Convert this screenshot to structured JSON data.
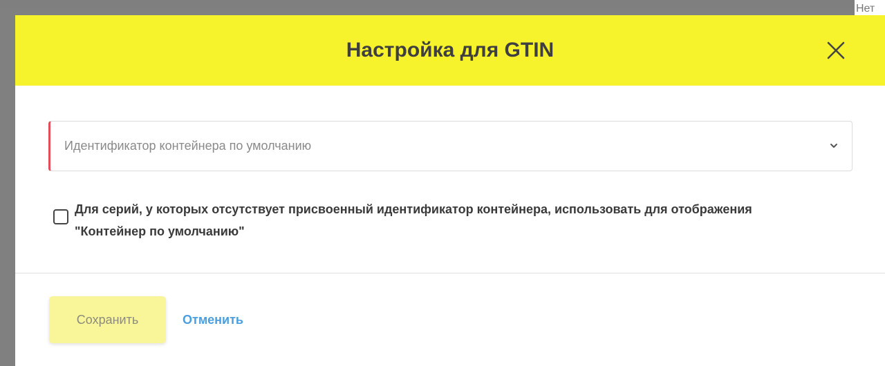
{
  "background": {
    "fragment_text": "Нет"
  },
  "dialog": {
    "title": "Настройка для GTIN",
    "close_icon": "close-icon",
    "header_color": "#f6f22b"
  },
  "form": {
    "container_select": {
      "placeholder": "Идентификатор контейнера по умолчанию",
      "value": "",
      "required_marker_color": "#e34d59",
      "icon": "chevron-down-icon"
    },
    "default_container_checkbox": {
      "checked": false,
      "label": "Для серий, у которых отсутствует присвоенный идентификатор контейнера, использовать для отображения \"Контейнер по умолчанию\""
    }
  },
  "footer": {
    "save_label": "Сохранить",
    "cancel_label": "Отменить",
    "save_color": "#f9f69a",
    "cancel_color": "#4a9fe0"
  }
}
